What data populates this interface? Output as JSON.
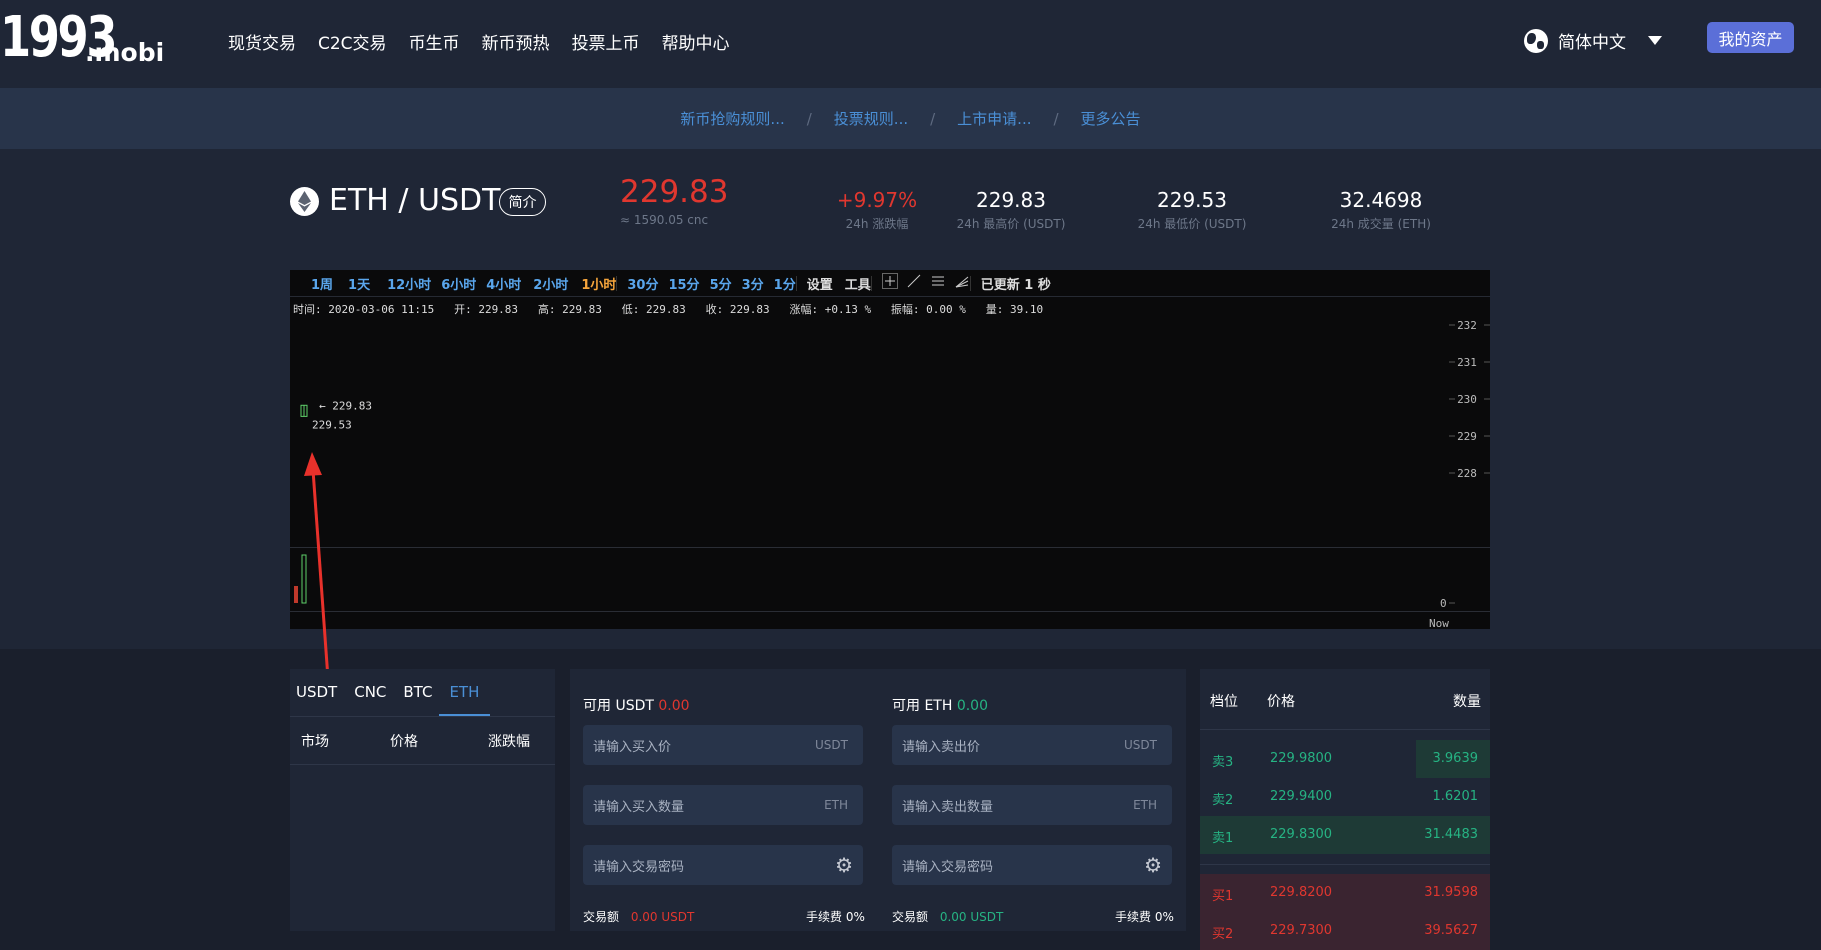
{
  "header": {
    "logo_main": "1993",
    "logo_suffix": ".mobi",
    "nav": [
      "现货交易",
      "C2C交易",
      "币生币",
      "新币预热",
      "投票上币",
      "帮助中心"
    ],
    "language": "简体中文",
    "assets_button": "我的资产"
  },
  "notices": [
    "新币抢购规则...",
    "投票规则...",
    "上市申请...",
    "更多公告"
  ],
  "notice_separator": "/",
  "ticker": {
    "pair": "ETH / USDT",
    "intro_button": "简介",
    "price": "229.83",
    "price_cnc": "≈ 1590.05 cnc",
    "change_value": "+9.97%",
    "change_label": "24h 涨跌幅",
    "high_value": "229.83",
    "high_label": "24h 最高价 (USDT)",
    "low_value": "229.53",
    "low_label": "24h 最低价 (USDT)",
    "volume_value": "32.4698",
    "volume_label": "24h 成交量 (ETH)"
  },
  "chart_toolbar": {
    "periods": [
      "1周",
      "1天",
      "12小时",
      "6小时",
      "4小时",
      "2小时",
      "1小时"
    ],
    "minutes": [
      "30分",
      "15分",
      "5分",
      "3分",
      "1分"
    ],
    "settings": "设置",
    "tools": "工具",
    "updated": "已更新 1 秒",
    "active_period": "1小时"
  },
  "chart_info": "时间: 2020-03-06 11:15   开: 229.83   高: 229.83   低: 229.83   收: 229.83   涨幅: +0.13 %   振幅: 0.00 %   量: 39.10",
  "chart_data": {
    "type": "candlestick",
    "yaxis_ticks": [
      "232",
      "231",
      "230",
      "229",
      "228"
    ],
    "volume_axis_tick": "0",
    "x_label": "Now",
    "label_high": "229.83",
    "label_low": "229.53",
    "candles": [
      {
        "open": 229.53,
        "high": 229.83,
        "low": 229.53,
        "close": 229.83,
        "volume": 39.1
      }
    ]
  },
  "markets": {
    "tabs": [
      "USDT",
      "CNC",
      "BTC",
      "ETH"
    ],
    "active_tab": "ETH",
    "columns": [
      "市场",
      "价格",
      "涨跌幅"
    ]
  },
  "trade": {
    "buy": {
      "avail_label": "可用 USDT",
      "avail_value": "0.00",
      "price_placeholder": "请输入买入价",
      "price_unit": "USDT",
      "amount_placeholder": "请输入买入数量",
      "amount_unit": "ETH",
      "password_placeholder": "请输入交易密码",
      "total_label": "交易额",
      "total_value": "0.00 USDT",
      "fee": "手续费 0%"
    },
    "sell": {
      "avail_label": "可用 ETH",
      "avail_value": "0.00",
      "price_placeholder": "请输入卖出价",
      "price_unit": "USDT",
      "amount_placeholder": "请输入卖出数量",
      "amount_unit": "ETH",
      "password_placeholder": "请输入交易密码",
      "total_label": "交易额",
      "total_value": "0.00 USDT",
      "fee": "手续费 0%"
    }
  },
  "orderbook": {
    "columns": [
      "档位",
      "价格",
      "数量"
    ],
    "asks": [
      {
        "level": "卖3",
        "price": "229.9800",
        "qty": "3.9639"
      },
      {
        "level": "卖2",
        "price": "229.9400",
        "qty": "1.6201"
      },
      {
        "level": "卖1",
        "price": "229.8300",
        "qty": "31.4483"
      }
    ],
    "bids": [
      {
        "level": "买1",
        "price": "229.8200",
        "qty": "31.9598"
      },
      {
        "level": "买2",
        "price": "229.7300",
        "qty": "39.5627"
      }
    ]
  },
  "colors": {
    "up": "#e0372f",
    "down": "#26b383",
    "accent": "#4a8fd6",
    "button": "#5b6fd8"
  }
}
